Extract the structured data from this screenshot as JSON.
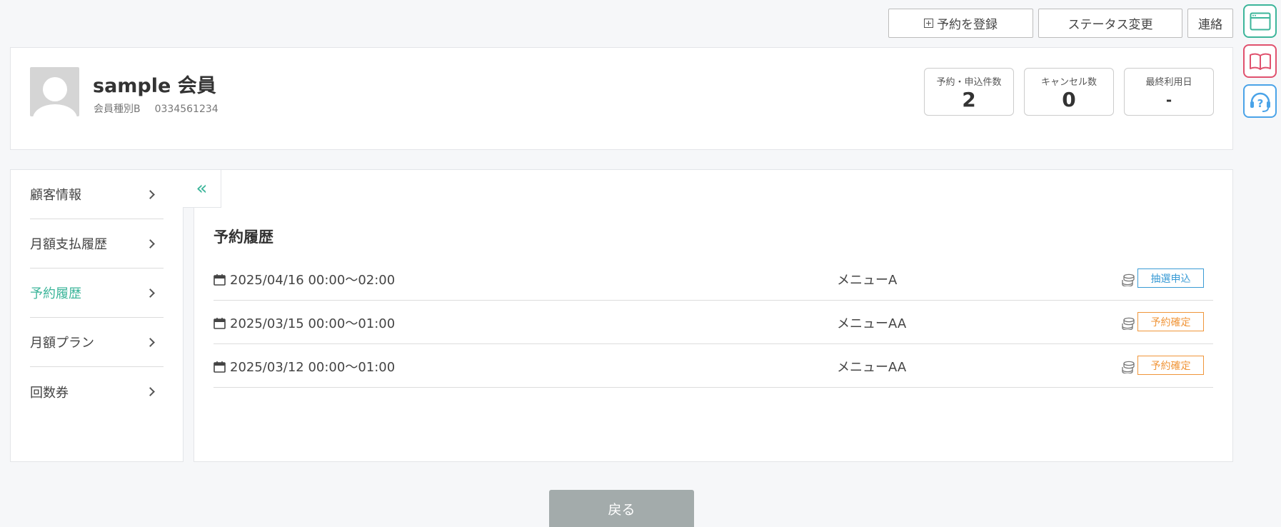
{
  "top_actions": {
    "add_reservation": "予約を登録",
    "status_change": "ステータス変更",
    "contact": "連絡"
  },
  "side_tools": [
    {
      "icon": "window-icon",
      "color": "#3cb59a"
    },
    {
      "icon": "book-icon",
      "color": "#e0516e"
    },
    {
      "icon": "help-headset-icon",
      "color": "#4aa3e8"
    }
  ],
  "member": {
    "name": "sample 会員",
    "type": "会員種別B",
    "phone": "0334561234"
  },
  "stats": [
    {
      "label": "予約・申込件数",
      "value": "2"
    },
    {
      "label": "キャンセル数",
      "value": "0"
    },
    {
      "label": "最終利用日",
      "value": "-"
    }
  ],
  "sidebar": {
    "items": [
      {
        "label": "顧客情報",
        "active": false
      },
      {
        "label": "月額支払履歴",
        "active": false
      },
      {
        "label": "予約履歴",
        "active": true
      },
      {
        "label": "月額プラン",
        "active": false
      },
      {
        "label": "回数券",
        "active": false
      }
    ],
    "collapse_icon": "«"
  },
  "main": {
    "title": "予約履歴",
    "reservations": [
      {
        "datetime": "2025/04/16 00:00〜02:00",
        "menu": "メニューA",
        "status": "抽選申込",
        "status_color": "#3a9bd5"
      },
      {
        "datetime": "2025/03/15 00:00〜01:00",
        "menu": "メニューAA",
        "status": "予約確定",
        "status_color": "#f0963a"
      },
      {
        "datetime": "2025/03/12 00:00〜01:00",
        "menu": "メニューAA",
        "status": "予約確定",
        "status_color": "#f0963a"
      }
    ]
  },
  "back_label": "戻る",
  "colors": {
    "accent": "#3cb59a",
    "page_bg": "#f6f7f9"
  }
}
